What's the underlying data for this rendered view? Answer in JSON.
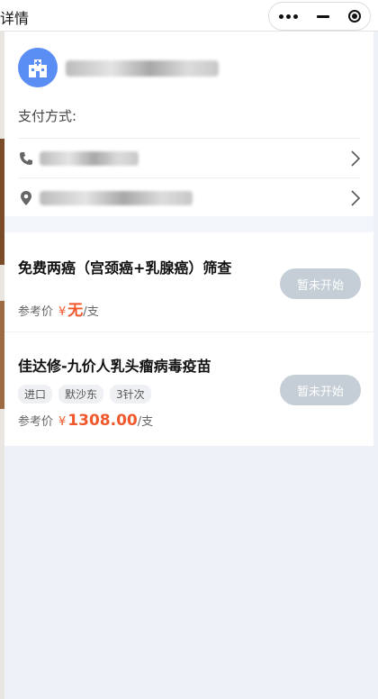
{
  "titlebar": {
    "title": "详情"
  },
  "header": {
    "payment_label": "支付方式:"
  },
  "items": [
    {
      "name": "免费两癌（宫颈癌+乳腺癌）筛查",
      "price_label": "参考价",
      "currency": "¥",
      "price": "无",
      "unit": "/支",
      "button": "暂未开始"
    },
    {
      "name": "佳达修-九价人乳头瘤病毒疫苗",
      "tags": [
        "进口",
        "默沙东",
        "3针次"
      ],
      "price_label": "参考价",
      "currency": "¥",
      "price": "1308.00",
      "unit": "/支",
      "button": "暂未开始"
    }
  ],
  "colors": {
    "accent": "#f0582c",
    "avatar": "#5b8ef5",
    "button_disabled": "#c5ced6"
  },
  "icons": [
    "more-icon",
    "minimize-icon",
    "record-icon",
    "hospital-icon",
    "phone-icon",
    "location-icon",
    "chevron-right-icon"
  ]
}
